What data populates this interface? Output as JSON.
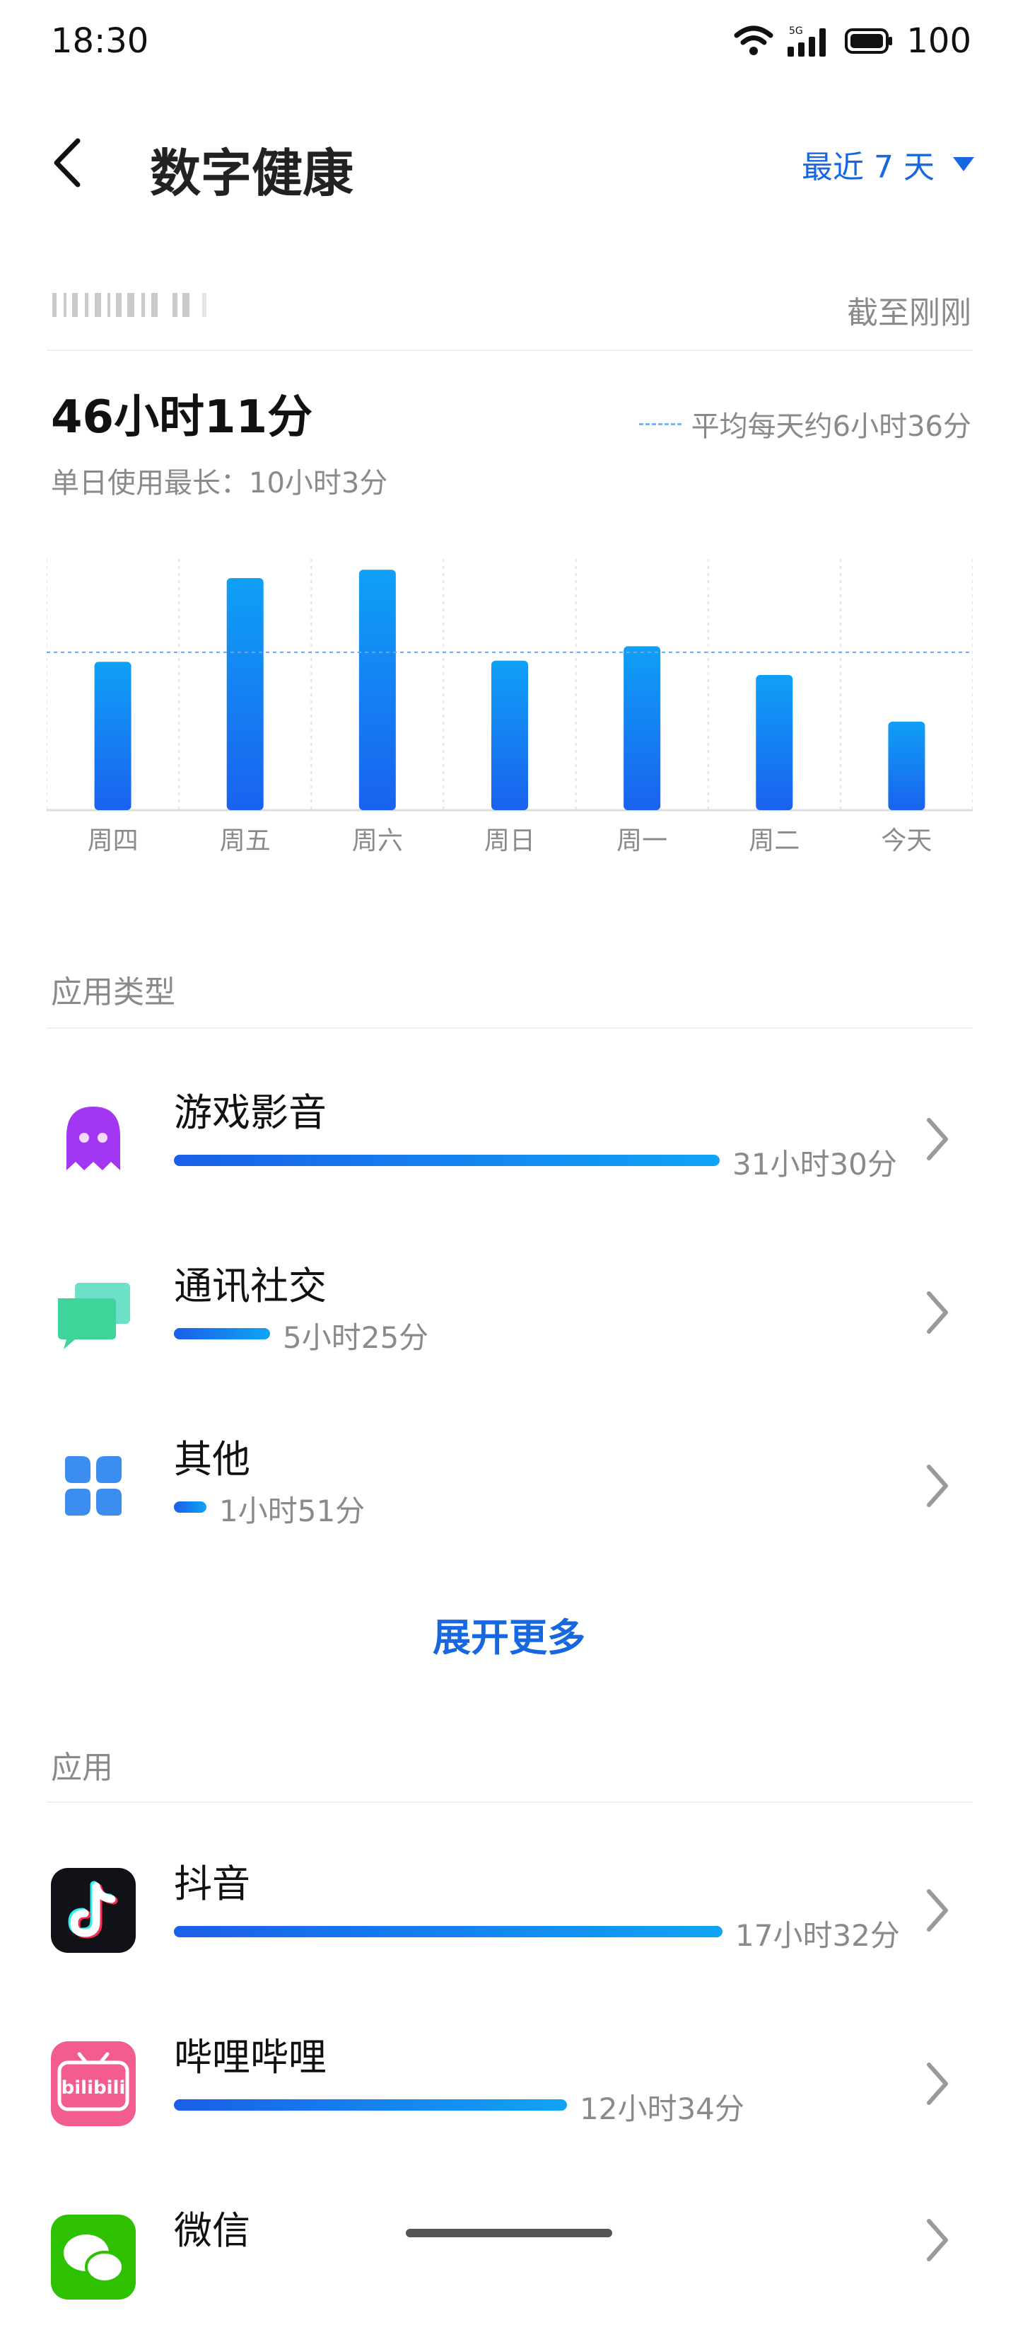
{
  "status": {
    "time": "18:30",
    "network": "5G",
    "battery": "100"
  },
  "header": {
    "title": "数字健康",
    "range": "最近 7 天"
  },
  "summary": {
    "updated": "截至刚刚",
    "total": "46小时11分",
    "average_legend": "平均每天约6小时36分",
    "max_day": "单日使用最长：10小时3分"
  },
  "chart_data": {
    "type": "bar",
    "categories": [
      "周四",
      "周五",
      "周六",
      "周日",
      "周一",
      "周二",
      "今天"
    ],
    "values": [
      6.2,
      9.7,
      10.05,
      6.25,
      6.85,
      5.65,
      3.7
    ],
    "average": 6.6,
    "ylim": [
      0,
      10.5
    ],
    "grid": "vertical dotted",
    "bar_color": "#1a7bf0"
  },
  "categories_section": {
    "title": "应用类型",
    "items": [
      {
        "name": "游戏影音",
        "duration": "31小时30分",
        "share": 1.0,
        "icon": "ghost-icon"
      },
      {
        "name": "通讯社交",
        "duration": "5小时25分",
        "share": 0.172,
        "icon": "chat-bubbles-icon"
      },
      {
        "name": "其他",
        "duration": "1小时51分",
        "share": 0.059,
        "icon": "four-petal-icon"
      }
    ],
    "expand": "展开更多"
  },
  "apps_section": {
    "title": "应用",
    "items": [
      {
        "name": "抖音",
        "duration": "17小时32分",
        "share": 1.0,
        "icon": "douyin-icon"
      },
      {
        "name": "哔哩哔哩",
        "duration": "12小时34分",
        "share": 0.717,
        "icon": "bilibili-icon",
        "icon_text": "bilibili"
      },
      {
        "name": "微信",
        "duration": "",
        "share": 0,
        "icon": "wechat-icon"
      }
    ]
  },
  "colors": {
    "accent": "#1667e0",
    "bar_start": "#1a5fe8",
    "bar_end": "#10a4f5",
    "muted": "#8a8a8a"
  }
}
